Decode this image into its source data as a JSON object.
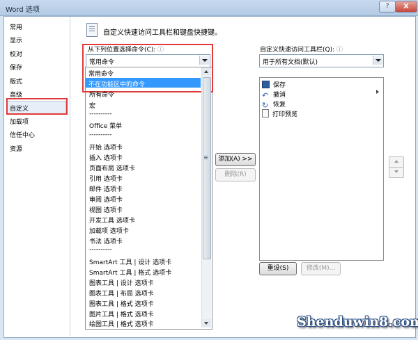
{
  "window": {
    "title": "Word 选项",
    "help_glyph": "?",
    "close_glyph": "X"
  },
  "nav": {
    "items": [
      {
        "label": "常用"
      },
      {
        "label": "显示"
      },
      {
        "label": "校对"
      },
      {
        "label": "保存"
      },
      {
        "label": "版式"
      },
      {
        "label": "高级"
      },
      {
        "label": "自定义",
        "selected": true
      },
      {
        "label": "加载项"
      },
      {
        "label": "信任中心"
      },
      {
        "label": "资源"
      }
    ]
  },
  "header": {
    "text": "自定义快速访问工具栏和键盘快捷键。"
  },
  "left": {
    "label": "从下列位置选择命令(C):",
    "info": "ⓘ",
    "select_value": "常用命令",
    "dropdown_items": [
      {
        "label": "常用命令",
        "highlighted": false
      },
      {
        "label": "不在功能区中的命令",
        "highlighted": true
      }
    ],
    "commands": [
      "所有命令",
      "宏",
      "----------",
      "Office 菜单",
      "----------",
      "开始 选项卡",
      "插入 选项卡",
      "页面布局 选项卡",
      "引用 选项卡",
      "邮件 选项卡",
      "审阅 选项卡",
      "视图 选项卡",
      "开发工具 选项卡",
      "加载项 选项卡",
      "书法 选项卡",
      "----------",
      "SmartArt 工具 | 设计 选项卡",
      "SmartArt 工具 | 格式 选项卡",
      "图表工具 | 设计 选项卡",
      "图表工具 | 布局 选项卡",
      "图表工具 | 格式 选项卡",
      "图片工具 | 格式 选项卡",
      "绘图工具 | 格式 选项卡"
    ]
  },
  "middle": {
    "add_label": "添加(A) >>",
    "remove_label": "删除(R)"
  },
  "right": {
    "label": "自定义快速访问工具栏(Q):",
    "info": "ⓘ",
    "select_value": "用于所有文档(默认)",
    "items": [
      {
        "label": "保存",
        "icon": "save-icon"
      },
      {
        "label": "撤消",
        "icon": "undo-icon"
      },
      {
        "label": "恢复",
        "icon": "redo-icon"
      },
      {
        "label": "打印预览",
        "icon": "print-preview-icon"
      }
    ],
    "reset_label": "重设(S)",
    "modify_label": "修改(M)..."
  },
  "watermark": {
    "text": "Shenduwin8.com"
  },
  "colors": {
    "highlight": "#3399ff",
    "annotation_red": "#e03a3a"
  }
}
